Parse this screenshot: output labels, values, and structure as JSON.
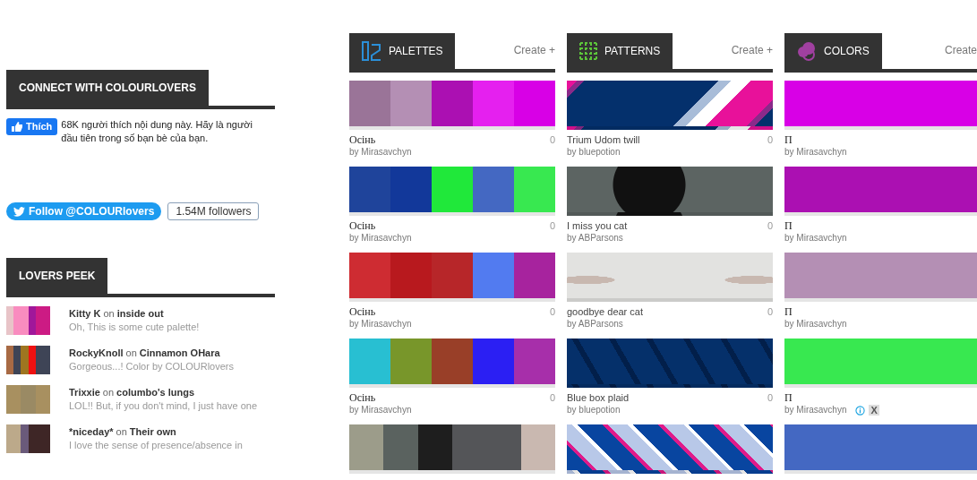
{
  "connect": {
    "title": "CONNECT WITH COLOURLOVERS",
    "like_button": "Thích",
    "like_text": "68K người thích nội dung này. Hãy là người đầu tiên trong số bạn bè của bạn.",
    "follow_button": "Follow @COLOURlovers",
    "followers": "1.54M followers"
  },
  "lovers_peek": {
    "title": "LOVERS PEEK",
    "items": [
      {
        "user": "Kitty K",
        "on": "on",
        "target": "inside out",
        "comment": "Oh, This is some cute palette!",
        "swatches": [
          {
            "color": "#e8c4c8"
          },
          {
            "color": "#f98cbf"
          },
          {
            "color": "#f98cbf"
          },
          {
            "color": "#a0179a"
          },
          {
            "color": "#cc1b84"
          },
          {
            "color": "#cc1b84"
          }
        ]
      },
      {
        "user": "RockyKnoll",
        "on": "on",
        "target": "Cinnamon OHara",
        "comment": "Gorgeous...! Color by COLOURlovers",
        "swatches": [
          {
            "color": "#a86a44"
          },
          {
            "color": "#3e4456"
          },
          {
            "color": "#9e7520"
          },
          {
            "color": "#ee1111"
          },
          {
            "color": "#3e4456"
          },
          {
            "color": "#3e4456"
          }
        ]
      },
      {
        "user": "Trixxie",
        "on": "on",
        "target": "columbo's lungs",
        "comment": "LOL!! But, if you don't mind, I just have one",
        "swatches": [
          {
            "color": "#a89060"
          },
          {
            "color": "#9a8a64"
          },
          {
            "color": "#a89060"
          }
        ]
      },
      {
        "user": "*niceday*",
        "on": "on",
        "target": "Their own",
        "comment": "I love the sense of presence/absence in",
        "swatches": [
          {
            "color": "#bca98a"
          },
          {
            "color": "#bca98a"
          },
          {
            "color": "#6a5a7a"
          },
          {
            "color": "#3e2626"
          },
          {
            "color": "#3e2626"
          },
          {
            "color": "#3e2626"
          }
        ]
      }
    ]
  },
  "sections": [
    {
      "kind": "palettes",
      "title": "PALETTES",
      "create": "Create +",
      "items": [
        {
          "title": "Осінь",
          "count": "0",
          "author": "by Mirasavchyn",
          "swatches": [
            {
              "color": "#9a7498"
            },
            {
              "color": "#b48fb4"
            },
            {
              "color": "#ab10b2"
            },
            {
              "color": "#e520ef"
            },
            {
              "color": "#d800e6"
            }
          ]
        },
        {
          "title": "Осінь",
          "count": "0",
          "author": "by Mirasavchyn",
          "swatches": [
            {
              "color": "#1f449b"
            },
            {
              "color": "#12389a"
            },
            {
              "color": "#20e83a"
            },
            {
              "color": "#4468c2"
            },
            {
              "color": "#38e850"
            }
          ]
        },
        {
          "title": "Осінь",
          "count": "0",
          "author": "by Mirasavchyn",
          "swatches": [
            {
              "color": "#ce2c32"
            },
            {
              "color": "#b8191e"
            },
            {
              "color": "#b72629"
            },
            {
              "color": "#527bf0"
            },
            {
              "color": "#a7239e"
            }
          ]
        },
        {
          "title": "Осінь",
          "count": "0",
          "author": "by Mirasavchyn",
          "swatches": [
            {
              "color": "#28bfd2"
            },
            {
              "color": "#78962a"
            },
            {
              "color": "#993f28"
            },
            {
              "color": "#2b1ff3"
            },
            {
              "color": "#a72faa"
            }
          ]
        },
        {
          "swatches": [
            {
              "color": "#9c9c8a"
            },
            {
              "color": "#5a625f"
            },
            {
              "color": "#1e1e1e"
            },
            {
              "color": "#545558"
            },
            {
              "color": "#545558"
            },
            {
              "color": "#c9b8b0"
            }
          ]
        }
      ]
    },
    {
      "kind": "patterns",
      "title": "PATTERNS",
      "create": "Create +",
      "items": [
        {
          "title": "Trium Udom twill",
          "count": "0",
          "author": "by bluepotion",
          "kind": "stripes"
        },
        {
          "title": "I miss you cat",
          "count": "0",
          "author": "by ABParsons",
          "kind": "photo"
        },
        {
          "title": "goodbye dear cat",
          "count": "0",
          "author": "by ABParsons",
          "kind": "sketch"
        },
        {
          "title": "Blue box plaid",
          "count": "0",
          "author": "by bluepotion",
          "kind": "lattice"
        },
        {
          "kind": "plaid"
        }
      ]
    },
    {
      "kind": "colors",
      "title": "COLORS",
      "create": "Create",
      "items": [
        {
          "title": "П",
          "author": "by Mirasavchyn",
          "swatches": [
            {
              "color": "#d800e6"
            }
          ]
        },
        {
          "title": "П",
          "author": "by Mirasavchyn",
          "swatches": [
            {
              "color": "#ab10b2"
            }
          ]
        },
        {
          "title": "П",
          "author": "by Mirasavchyn",
          "swatches": [
            {
              "color": "#b48fb4"
            }
          ]
        },
        {
          "title": "П",
          "author": "by Mirasavchyn",
          "swatches": [
            {
              "color": "#38e850"
            }
          ],
          "ad_close": "X"
        },
        {
          "swatches": [
            {
              "color": "#4468c2"
            }
          ]
        }
      ]
    }
  ]
}
